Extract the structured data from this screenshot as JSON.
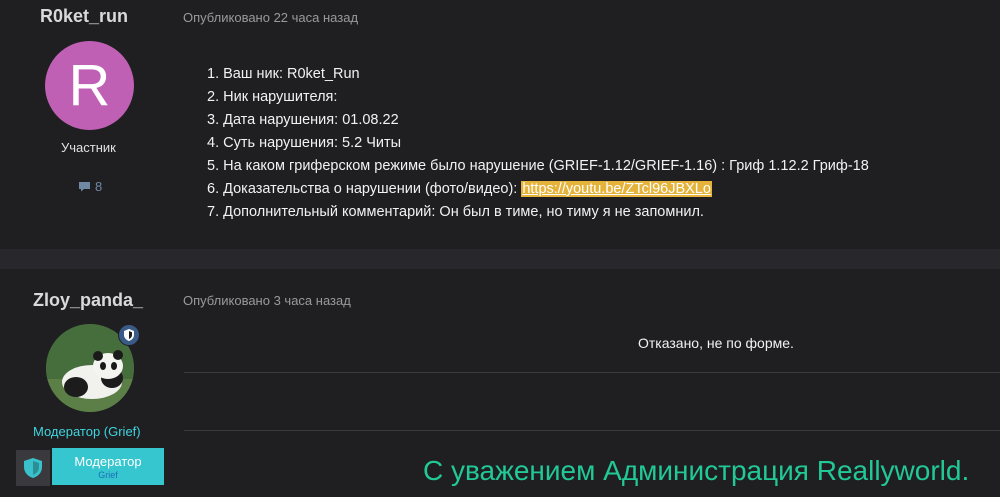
{
  "post1": {
    "author": "R0ket_run",
    "published": "Опубликовано 22 часа назад",
    "avatar_letter": "R",
    "role": "Участник",
    "post_count": "8",
    "lines": [
      "1. Ваш ник: R0ket_Run",
      "2. Ник нарушителя:",
      "3. Дата нарушения: 01.08.22",
      "4. Суть нарушения: 5.2 Читы",
      "5. На каком гриферском режиме было нарушение (GRIEF-1.12/GRIEF-1.16) : Гриф 1.12.2 Гриф-18",
      "6. Доказательства о нарушении (фото/видео): ",
      "7. Дополнительный комментарий: Он был в тиме, но тиму я не запомнил."
    ],
    "evidence_link": "https://youtu.be/ZTcl96JBXLo"
  },
  "post2": {
    "author": "Zloy_panda_",
    "published": "Опубликовано 3 часа назад",
    "role": "Модератор (Grief)",
    "badge_title": "Модератор",
    "badge_sub": "Grief",
    "answer": "Отказано, не по форме."
  },
  "watermark": "С уважением Администрация Reallyworld.",
  "colors": {
    "accent_teal": "#36c6cf",
    "link_bg": "#e5b339",
    "watermark": "#21c996",
    "avatar_bg": "#c060b4"
  }
}
